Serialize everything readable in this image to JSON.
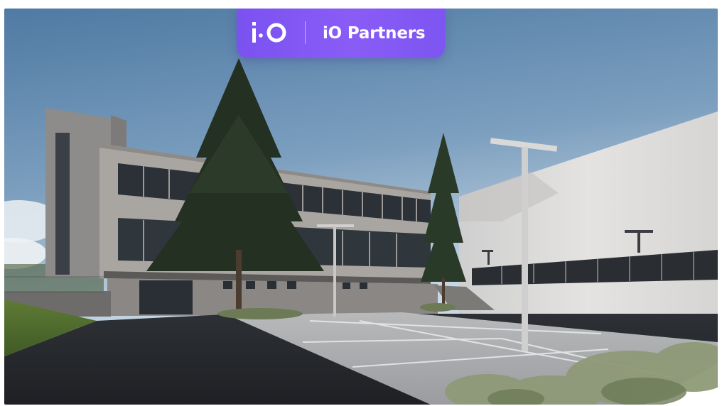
{
  "brand": {
    "name": "iO Partners",
    "logo_icon": "io-logo-icon",
    "accent_color": "#8259f4"
  },
  "scene": {
    "icon": "building-rendering",
    "sky_color": "#5f86ab",
    "facade_color": "#a9a6a2"
  }
}
